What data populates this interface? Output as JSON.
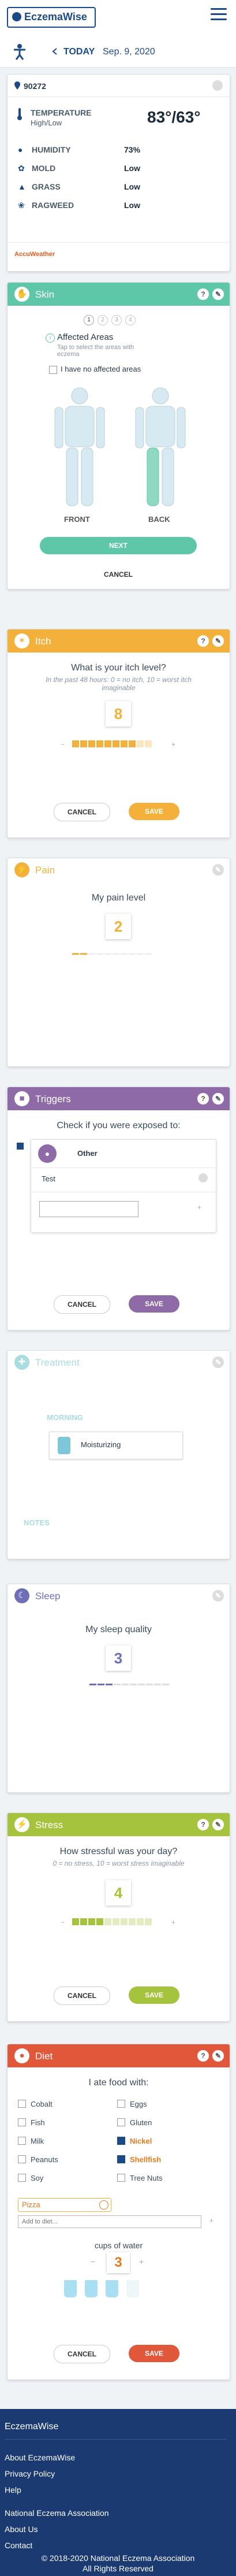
{
  "header": {
    "logo_text": "EczemaWise",
    "menu_icon": "hamburger-icon"
  },
  "datebar": {
    "today_label": "TODAY",
    "date": "Sep. 9, 2020"
  },
  "weather": {
    "zip": "90272",
    "temp_label": "TEMPERATURE",
    "temp_sub": "High/Low",
    "temp_value": "83°/63°",
    "rows": [
      {
        "label": "HUMIDITY",
        "value": "73%"
      },
      {
        "label": "MOLD",
        "value": "Low"
      },
      {
        "label": "GRASS",
        "value": "Low"
      },
      {
        "label": "RAGWEED",
        "value": "Low"
      }
    ],
    "brand": "AccuWeather"
  },
  "skin": {
    "title": "Skin",
    "color": "#5ec7a8",
    "steps": [
      "1",
      "2",
      "3",
      "4"
    ],
    "affected_title": "Affected Areas",
    "affected_hint": "Tap to select the areas with eczema",
    "no_affected": "I have no affected areas",
    "front": "FRONT",
    "back": "BACK",
    "next": "NEXT",
    "cancel": "CANCEL"
  },
  "itch": {
    "title": "Itch",
    "color": "#f3b13b",
    "question": "What is your itch level?",
    "sub": "In the past 48 hours: 0 = no itch, 10 = worst itch imaginable",
    "value": "8",
    "level": 8,
    "cancel": "CANCEL",
    "save": "SAVE"
  },
  "pain": {
    "title": "Pain",
    "color": "#f3b13b",
    "question": "My pain level",
    "value": "2",
    "level": 2
  },
  "triggers": {
    "title": "Triggers",
    "color": "#8e6aa6",
    "question": "Check if you were exposed to:",
    "other_label": "Other",
    "entry": "Test",
    "cancel": "CANCEL",
    "save": "SAVE"
  },
  "treatment": {
    "title": "Treatment",
    "color": "#a9dde0",
    "morning": "MORNING",
    "item": "Moisturizing",
    "notes": "NOTES"
  },
  "sleep": {
    "title": "Sleep",
    "color": "#6f6fb8",
    "question": "My sleep quality",
    "value": "3",
    "level": 3
  },
  "stress": {
    "title": "Stress",
    "color": "#a6c33d",
    "question": "How stressful was your day?",
    "sub": "0 = no stress, 10 = worst stress imaginable",
    "value": "4",
    "level": 4,
    "cancel": "CANCEL",
    "save": "SAVE"
  },
  "diet": {
    "title": "Diet",
    "color": "#e0573a",
    "question": "I ate food with:",
    "left": [
      {
        "label": "Cobalt",
        "on": false
      },
      {
        "label": "Fish",
        "on": false
      },
      {
        "label": "Milk",
        "on": false
      },
      {
        "label": "Peanuts",
        "on": false
      },
      {
        "label": "Soy",
        "on": false
      }
    ],
    "right": [
      {
        "label": "Eggs",
        "on": false
      },
      {
        "label": "Gluten",
        "on": false
      },
      {
        "label": "Nickel",
        "on": true
      },
      {
        "label": "Shellfish",
        "on": true
      },
      {
        "label": "Tree Nuts",
        "on": false
      }
    ],
    "custom_tag": "Pizza",
    "add_placeholder": "Add to diet...",
    "water_label": "cups of water",
    "water_value": "3",
    "cancel": "CANCEL",
    "save": "SAVE"
  },
  "footer": {
    "brand": "EczemaWise",
    "links": [
      "About EczemaWise",
      "Privacy Policy",
      "Help",
      "National Eczema Association",
      "About Us",
      "Contact"
    ],
    "copyright1": "© 2018-2020 National Eczema Association",
    "copyright2": "All Rights Reserved"
  }
}
